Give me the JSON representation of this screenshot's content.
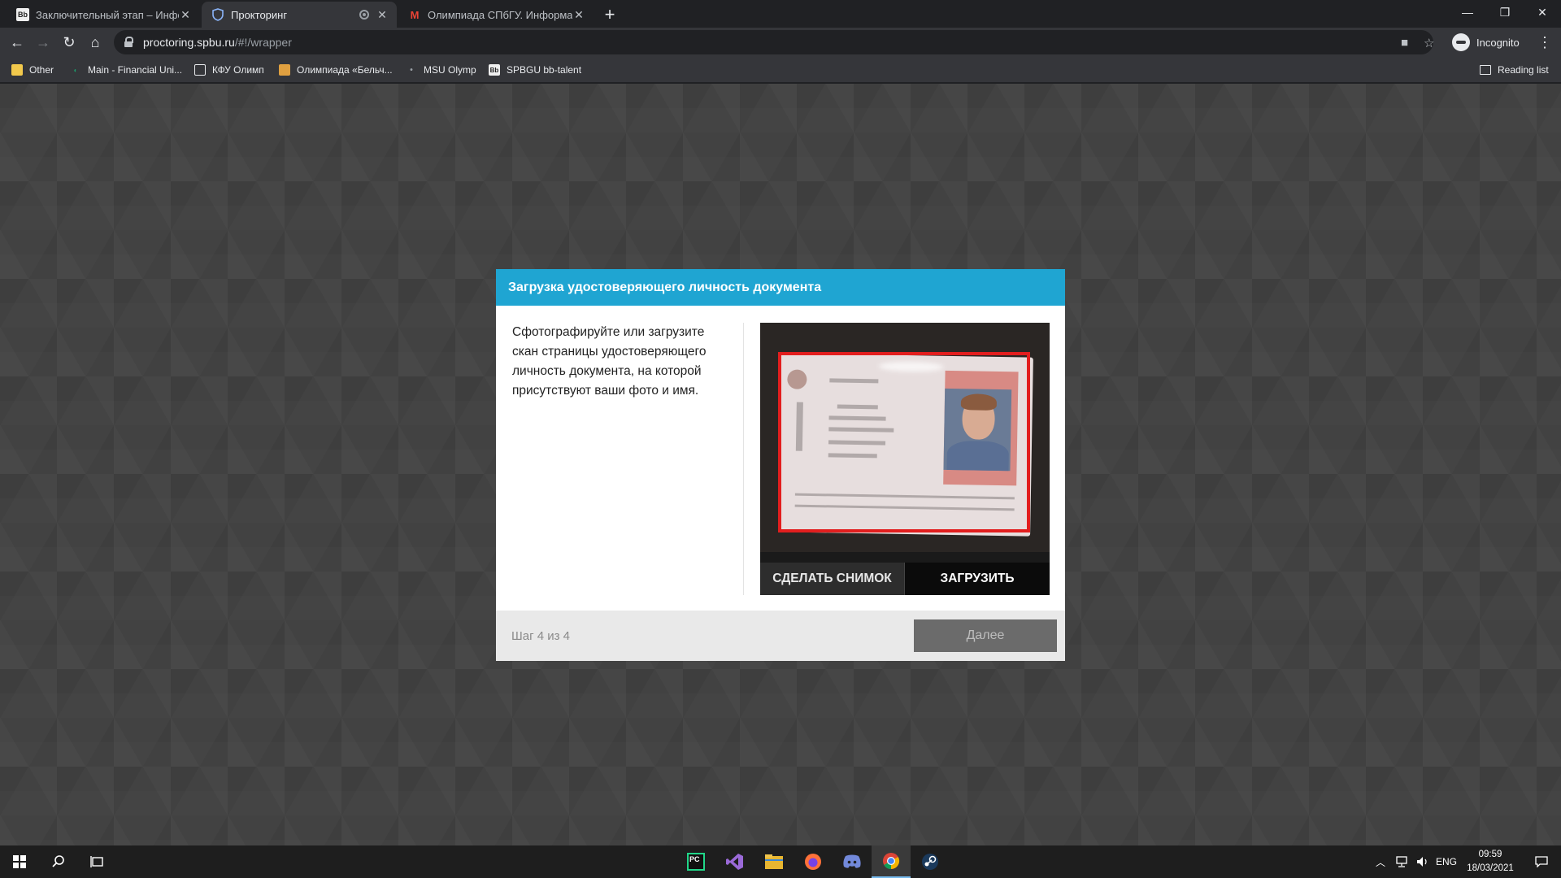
{
  "browser": {
    "tabs": [
      {
        "label": "Заключительный этап – Инфор",
        "favicon": "Bb"
      },
      {
        "label": "Прокторинг",
        "favicon": "shield"
      },
      {
        "label": "Олимпиада СПбГУ. Информати",
        "favicon": "M"
      }
    ],
    "address": {
      "host": "proctoring.spbu.ru",
      "path": "/#!/wrapper"
    },
    "profile_label": "Incognito",
    "bookmarks": [
      {
        "label": "Other",
        "icon": "folder-icon"
      },
      {
        "label": "Main - Financial Uni...",
        "icon": "leaf-icon"
      },
      {
        "label": "КФУ Олимп",
        "icon": "building-icon"
      },
      {
        "label": "Олимпиада «Бельч...",
        "icon": "grid-icon"
      },
      {
        "label": "MSU Olymp",
        "icon": "dot-icon"
      },
      {
        "label": "SPBGU bb-talent",
        "icon": "Bb"
      }
    ],
    "reading_list_label": "Reading list"
  },
  "modal": {
    "title": "Загрузка удостоверяющего личность документа",
    "instructions": "Сфотографируйте или загрузите скан страницы удостоверяющего личность документа, на которой присутствуют ваши фото и имя.",
    "snapshot_button": "СДЕЛАТЬ СНИМОК",
    "upload_button": "ЗАГРУЗИТЬ",
    "step_text": "Шаг 4 из 4",
    "next_button": "Далее",
    "header_color": "#1fa5d2",
    "frame_color": "#e21e1e"
  },
  "taskbar": {
    "apps": [
      "pycharm-icon",
      "visual-studio-icon",
      "file-explorer-icon",
      "firefox-icon",
      "discord-icon",
      "chrome-icon",
      "steam-icon"
    ],
    "language": "ENG",
    "time": "09:59",
    "date": "18/03/2021"
  }
}
